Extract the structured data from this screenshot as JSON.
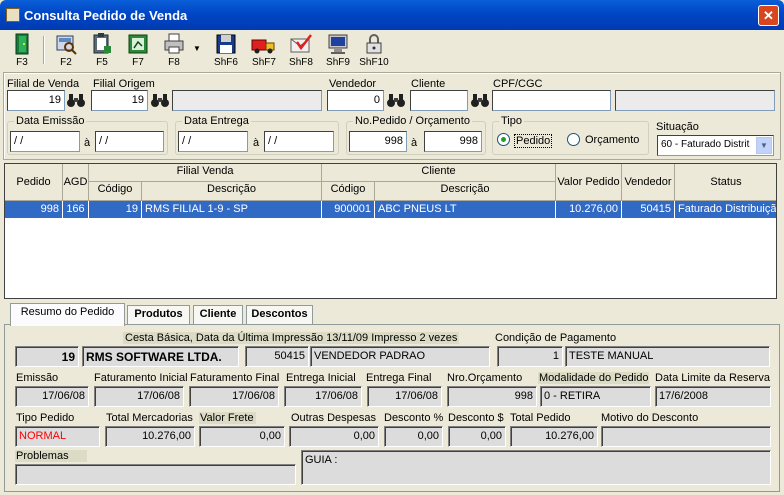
{
  "window": {
    "title": "Consulta Pedido de Venda",
    "close": "✕"
  },
  "toolbar": [
    {
      "label": "F3",
      "icon": "exit-door-icon"
    },
    {
      "label": "F2",
      "icon": "print-preview-icon"
    },
    {
      "label": "F5",
      "icon": "clipboard-icon"
    },
    {
      "label": "F7",
      "icon": "excel-icon"
    },
    {
      "label": "F8",
      "icon": "printer-icon"
    },
    {
      "label": "ShF6",
      "icon": "save-disk-icon"
    },
    {
      "label": "ShF7",
      "icon": "delivery-truck-icon"
    },
    {
      "label": "ShF8",
      "icon": "mail-check-icon"
    },
    {
      "label": "ShF9",
      "icon": "monitor-icon"
    },
    {
      "label": "ShF10",
      "icon": "padlock-icon"
    }
  ],
  "filter": {
    "filial_venda_label": "Filial de Venda",
    "filial_venda": "19",
    "filial_origem_label": "Filial Origem",
    "filial_origem": "19",
    "filial_origem_desc": "",
    "vendedor_label": "Vendedor",
    "vendedor": "0",
    "cliente_label": "Cliente",
    "cliente": "",
    "cpf_label": "CPF/CGC",
    "cpf": "",
    "cpf_desc": "",
    "data_emissao_label": "Data Emissão",
    "data_emissao_de": "/ /",
    "data_emissao_ate": "/ /",
    "a1": "à",
    "data_entrega_label": "Data Entrega",
    "data_entrega_de": "/ /",
    "data_entrega_ate": "/ /",
    "a2": "à",
    "nopedido_label": "No.Pedido / Orçamento",
    "nopedido_de": "998",
    "nopedido_ate": "998",
    "a3": "à",
    "tipo_label": "Tipo",
    "tipo_pedido": "Pedido",
    "tipo_orcamento": "Orçamento",
    "situacao_label": "Situação",
    "situacao": "60 - Faturado Distrit"
  },
  "grid": {
    "headers": {
      "pedido": "Pedido",
      "agd": "AGD",
      "filial_venda": "Filial Venda",
      "codigo": "Código",
      "descricao": "Descrição",
      "cliente": "Cliente",
      "codigo2": "Código",
      "descricao2": "Descrição",
      "valor": "Valor Pedido",
      "vendedor": "Vendedor",
      "status": "Status"
    },
    "row": {
      "pedido": "998",
      "agd": "166",
      "codigo": "19",
      "descricao": "RMS FILIAL 1-9 - SP",
      "cliente_codigo": "900001",
      "cliente_descricao": "ABC PNEUS LT",
      "valor": "10.276,00",
      "vendedor": "50415",
      "status": "Faturado Distribuiçã"
    }
  },
  "tabs": [
    "Resumo do Pedido",
    "Produtos",
    "Cliente",
    "Descontos"
  ],
  "resumo": {
    "cesta_info": "Cesta Básica, Data da Última Impressão 13/11/09 Impresso 2 vezes",
    "condicao_label": "Condição de Pagamento",
    "filial": "19",
    "filial_nome": "RMS SOFTWARE LTDA.",
    "vendedor": "50415",
    "vendedor_nome": "VENDEDOR PADRAO",
    "condicao_cod": "1",
    "condicao_desc": "TESTE MANUAL",
    "emissao_label": "Emissão",
    "emissao": "17/06/08",
    "fat_ini_label": "Faturamento Inicial",
    "fat_ini": "17/06/08",
    "fat_fin_label": "Faturamento Final",
    "fat_fin": "17/06/08",
    "ent_ini_label": "Entrega Inicial",
    "ent_ini": "17/06/08",
    "ent_fin_label": "Entrega Final",
    "ent_fin": "17/06/08",
    "nro_orc_label": "Nro.Orçamento",
    "nro_orc": "998",
    "modalidade_label": "Modalidade do Pedido",
    "modalidade": "0 - RETIRA",
    "data_limite_label": "Data Limite da Reserva",
    "data_limite": "17/6/2008",
    "tipo_pedido_label": "Tipo Pedido",
    "tipo_pedido": "NORMAL",
    "tipo_pedido_color": "#ff0000",
    "total_merc_label": "Total Mercadorias",
    "total_merc": "10.276,00",
    "valor_frete_label": "Valor Frete",
    "valor_frete": "0,00",
    "outras_label": "Outras Despesas",
    "outras": "0,00",
    "desc_pct_label": "Desconto %",
    "desc_pct": "0,00",
    "desc_val_label": "Desconto $",
    "desc_val": "0,00",
    "total_ped_label": "Total Pedido",
    "total_ped": "10.276,00",
    "motivo_label": "Motivo do Desconto",
    "motivo": "",
    "problemas_label": "Problemas",
    "problemas": "",
    "guia": "GUIA :"
  }
}
